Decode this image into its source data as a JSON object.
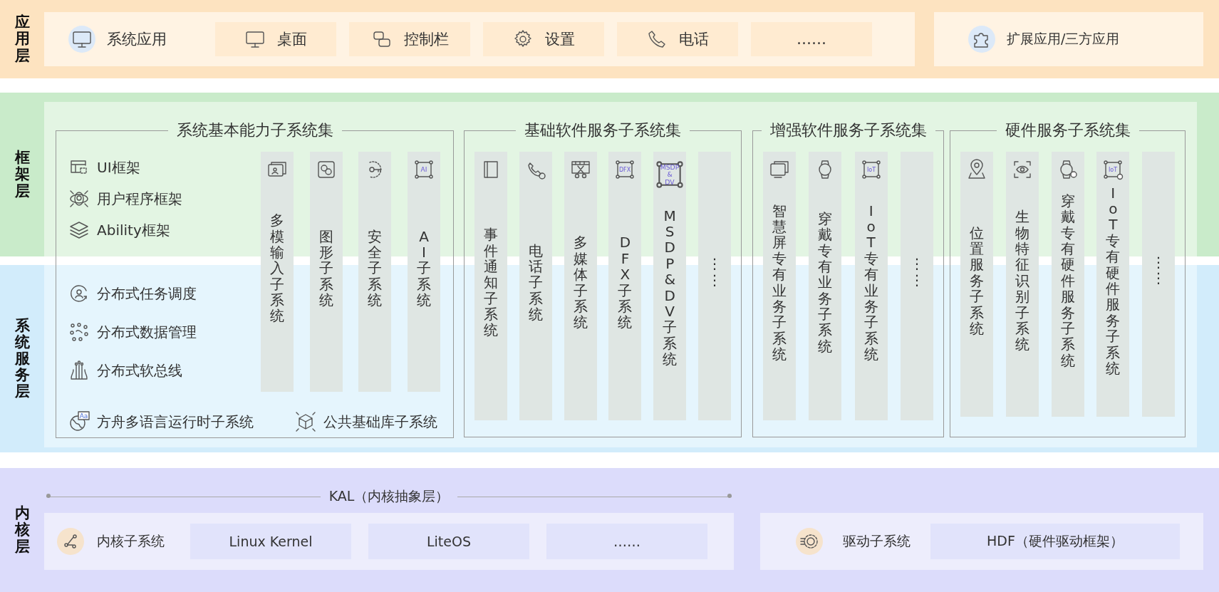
{
  "application_layer": {
    "label": "应用层",
    "system_apps": {
      "title": "系统应用",
      "items": [
        "桌面",
        "控制栏",
        "设置",
        "电话",
        "……"
      ]
    },
    "extension_apps": {
      "title": "扩展应用/三方应用"
    }
  },
  "framework_layer": {
    "label": "框架层"
  },
  "system_service_layer": {
    "label": "系统服务层"
  },
  "subsystem_sets": [
    {
      "title": "系统基本能力子系统集",
      "frameworks": [
        "UI框架",
        "用户程序框架",
        "Ability框架"
      ],
      "distributed_services": [
        "分布式任务调度",
        "分布式数据管理",
        "分布式软总线"
      ],
      "columns": [
        {
          "title": "多模输入子系统"
        },
        {
          "title": "图形子系统"
        },
        {
          "title": "安全子系统"
        },
        {
          "title": "AI子系统",
          "icon_text": [
            "AI"
          ]
        }
      ],
      "bottom_items": [
        {
          "title": "方舟多语言运行时子系统",
          "icon_text": [
            "Aa"
          ]
        },
        {
          "title": "公共基础库子系统"
        }
      ]
    },
    {
      "title": "基础软件服务子系统集",
      "columns": [
        {
          "title": "事件通知子系统"
        },
        {
          "title": "电话子系统"
        },
        {
          "title": "多媒体子系统"
        },
        {
          "title": "DFX子系统",
          "icon_text": [
            "DFX"
          ]
        },
        {
          "title": "MSDP&DV子系统",
          "icon_text": [
            "MSDP",
            "&",
            "DV"
          ]
        },
        {
          "title": "⋮⋮"
        }
      ]
    },
    {
      "title": "增强软件服务子系统集",
      "columns": [
        {
          "title": "智慧屏专有业务子系统"
        },
        {
          "title": "穿戴专有业务子系统"
        },
        {
          "title": "IoT专有业务子系统",
          "icon_text": [
            "IoT"
          ]
        },
        {
          "title": "⋮⋮"
        }
      ]
    },
    {
      "title": "硬件服务子系统集",
      "columns": [
        {
          "title": "位置服务子系统"
        },
        {
          "title": "生物特征识别子系统"
        },
        {
          "title": "穿戴专有硬件服务子系统"
        },
        {
          "title": "IoT专有硬件服务子系统",
          "icon_text": [
            "IoT"
          ]
        },
        {
          "title": "⋮⋮"
        }
      ]
    }
  ],
  "kernel_layer": {
    "label": "内核层",
    "kal": "KAL（内核抽象层）",
    "kernel": {
      "title": "内核子系统",
      "items": [
        "Linux Kernel",
        "LiteOS",
        "……"
      ]
    },
    "driver": {
      "title": "驱动子系统",
      "hdf": "HDF（硬件驱动框架）"
    }
  }
}
